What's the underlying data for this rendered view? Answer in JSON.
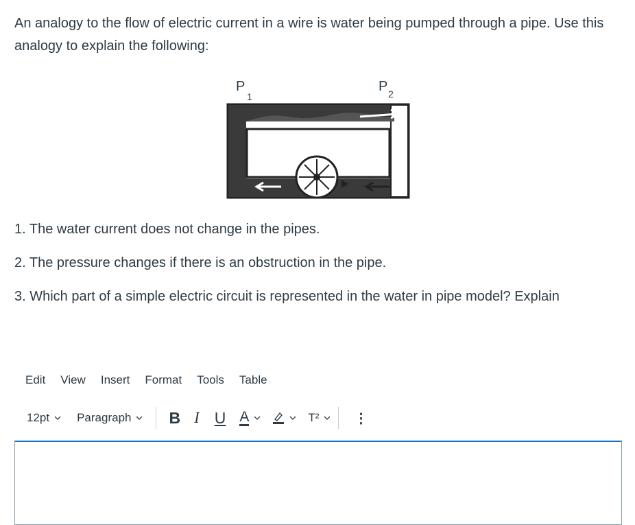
{
  "question": {
    "intro": "An analogy to the flow of electric current in a wire is water being pumped through a pipe.  Use this analogy to explain the following:"
  },
  "diagram": {
    "p1_label": "P",
    "p1_sub": "1",
    "p2_label": "P",
    "p2_sub": "2"
  },
  "items": [
    "1. The water current does not change in the pipes.",
    "2. The pressure changes if there is an obstruction in the pipe.",
    "3. Which part of a simple electric circuit is represented in the water in pipe model? Explain"
  ],
  "editor": {
    "menu": [
      "Edit",
      "View",
      "Insert",
      "Format",
      "Tools",
      "Table"
    ],
    "font_size": "12pt",
    "block_format": "Paragraph",
    "bold": "B",
    "italic": "I",
    "underline": "U",
    "text_color": "A",
    "superscript": "T²",
    "more": "⋮",
    "icons": {
      "highlight": "highlighter-icon",
      "chevron": "chevron-down-icon",
      "more": "more-vertical-icon"
    },
    "content": ""
  }
}
